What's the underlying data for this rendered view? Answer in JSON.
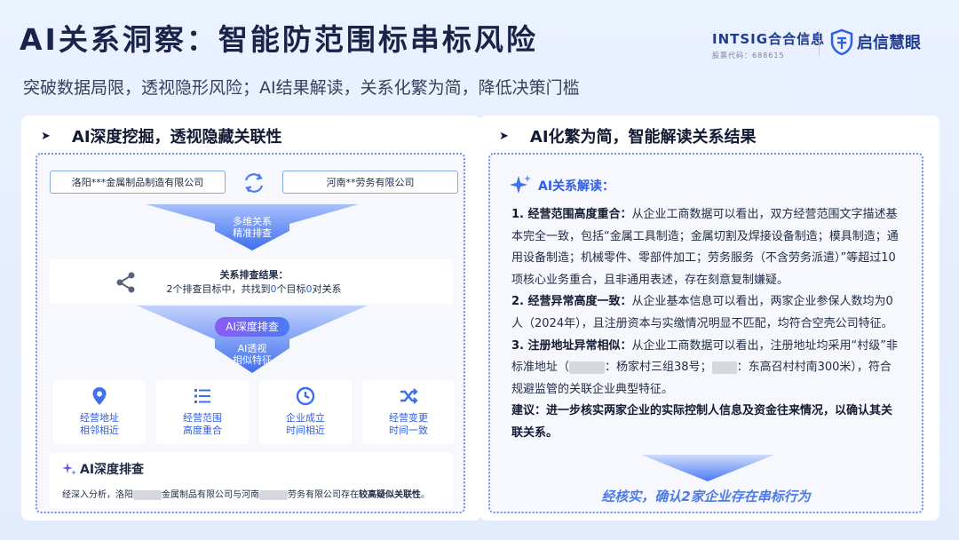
{
  "header": {
    "title": "AI关系洞察：智能防范围标串标风险",
    "subtitle": "突破数据局限，透视隐形风险；AI结果解读，关系化繁为简，降低决策门槛"
  },
  "logos": {
    "intsig_wordmark": "INTSIG合合信息",
    "intsig_stock": "股票代码：688615",
    "qixin": "启信慧眼"
  },
  "left_panel": {
    "heading": "AI深度挖掘，透视隐藏关联性",
    "company_a": "洛阳***金属制品制造有限公司",
    "company_b": "河南**劳务有限公司",
    "funnel1": [
      "多维关系",
      "精准排查"
    ],
    "result_title": "关系排查结果：",
    "result_prefix": "2个排查目标中，共找到",
    "result_n1": "0",
    "result_mid": "个目标",
    "result_n2": "0",
    "result_suffix": "对关系",
    "ai_pill": "AI深度排查",
    "funnel2": [
      "AI透视",
      "相似特征"
    ],
    "features": [
      {
        "icon": "location-icon",
        "line1": "经营地址",
        "line2": "相邻相近"
      },
      {
        "icon": "list-icon",
        "line1": "经营范围",
        "line2": "高度重合"
      },
      {
        "icon": "clock-icon",
        "line1": "企业成立",
        "line2": "时间相近"
      },
      {
        "icon": "shuffle-icon",
        "line1": "经营变更",
        "line2": "时间一致"
      }
    ],
    "deep_title": "AI深度排查",
    "deep_text_1": "经深入分析，洛阳",
    "deep_text_2": "金属制品有限公司与河南",
    "deep_text_3": "劳务有限公司存在",
    "deep_text_bold": "较高疑似关联性",
    "deep_text_end": "。"
  },
  "right_panel": {
    "heading": "AI化繁为简，智能解读关系结果",
    "analysis_title": "AI关系解读：",
    "p1_bold": "1. 经营范围高度重合：",
    "p1": "从企业工商数据可以看出，双方经营范围文字描述基本完全一致，包括“金属工具制造；金属切割及焊接设备制造；模具制造；通用设备制造；机械零件、零部件加工；劳务服务（不含劳务派遣）”等超过10项核心业务重合，且非通用表述，存在刻意复制嫌疑。",
    "p2_bold": "2. 经营异常高度一致：",
    "p2": "从企业基本信息可以看出，两家企业参保人数均为0人（2024年），且注册资本与实缴情况明显不匹配，均符合空壳公司特征。",
    "p3_bold": "3. 注册地址异常相似：",
    "p3_a": "从企业工商数据可以看出，注册地址均采用“村级”非标准地址（",
    "p3_b": "：杨家村三组38号；",
    "p3_c": "：东高召村村南300米），符合规避监管的关联企业典型特征。",
    "p4_bold": "建议：进一步核实两家企业的实际控制人信息及资金往来情况，以确认其关联关系。",
    "conclusion": "经核实，确认2家企业存在串标行为"
  },
  "colors": {
    "accent": "#2f5ee6",
    "funnel": "#3f6ff0",
    "pill_start": "#8a5cf0",
    "pill_end": "#4a7bf5"
  }
}
